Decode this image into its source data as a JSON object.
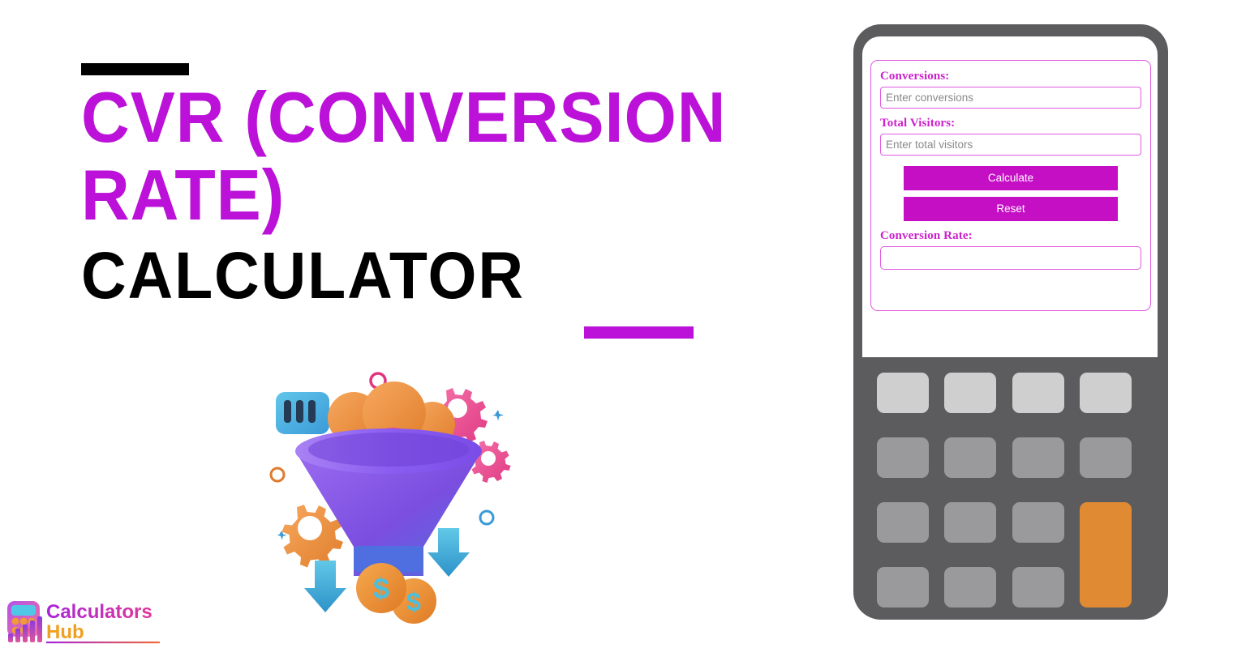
{
  "page": {
    "background": "#ffffff",
    "accent_magenta": "#bb11d8",
    "accent_black": "#000000",
    "button_magenta": "#c40fc4",
    "label_magenta": "#cc22cc",
    "border_magenta": "#e05ae0",
    "device_gray": "#5c5c5f",
    "key_light": "#cfcfcf",
    "key_gray": "#9a9a9c",
    "key_orange": "#e08a33"
  },
  "hero": {
    "title_line_1": "CVR (CONVERSION",
    "title_line_2": "RATE)",
    "title_line_3": "CALCULATOR",
    "rule_top_color": "#000000",
    "rule_bottom_color": "#bb11d8"
  },
  "logo": {
    "word_1": "Calculators",
    "word_2": "Hub",
    "word_1_color": "#b11fd0",
    "word_2_color": "#f0a020"
  },
  "illustration": {
    "name": "conversion-funnel-3d",
    "elements": [
      "funnel",
      "spheres",
      "gears",
      "coins",
      "arrows",
      "chart-card"
    ]
  },
  "calculator": {
    "form": {
      "fields": [
        {
          "label": "Conversions:",
          "placeholder": "Enter conversions",
          "value": ""
        },
        {
          "label": "Total Visitors:",
          "placeholder": "Enter total visitors",
          "value": ""
        }
      ],
      "buttons": [
        {
          "label": "Calculate"
        },
        {
          "label": "Reset"
        }
      ],
      "result": {
        "label": "Conversion Rate:",
        "placeholder": "",
        "value": ""
      }
    },
    "keypad": {
      "rows": 4,
      "columns": 4,
      "row1_style": "light",
      "orange_key_position": "col4-rows3to4"
    }
  }
}
